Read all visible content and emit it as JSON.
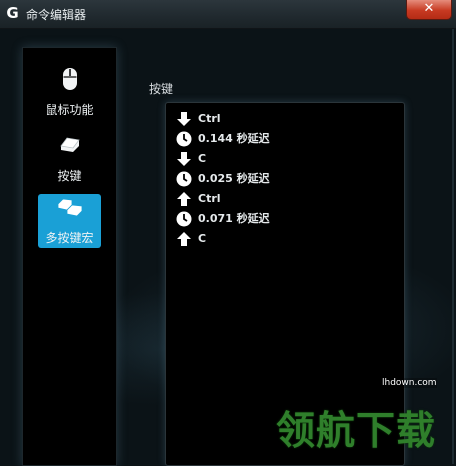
{
  "window": {
    "title": "命令编辑器",
    "logo_letter": "G",
    "ghost_text": "     ",
    "close_label": "✕"
  },
  "sidebar": {
    "items": [
      {
        "label": "鼠标功能",
        "icon": "mouse-icon",
        "active": false
      },
      {
        "label": "按键",
        "icon": "key-icon",
        "active": false
      },
      {
        "label": "多按键宏",
        "icon": "multi-key-icon",
        "active": true
      }
    ]
  },
  "main": {
    "section_label": "按键",
    "events": [
      {
        "icon": "arrow-down-icon",
        "text": "Ctrl"
      },
      {
        "icon": "clock-icon",
        "text": "0.144 秒延迟"
      },
      {
        "icon": "arrow-down-icon",
        "text": "C"
      },
      {
        "icon": "clock-icon",
        "text": "0.025 秒延迟"
      },
      {
        "icon": "arrow-up-icon",
        "text": "Ctrl"
      },
      {
        "icon": "clock-icon",
        "text": "0.071 秒延迟"
      },
      {
        "icon": "arrow-up-icon",
        "text": "C"
      }
    ]
  },
  "watermark": {
    "url": "lhdown.com",
    "text": "领航下载"
  },
  "colors": {
    "accent": "#1aa0d6",
    "close": "#c73a22",
    "watermark": "#2f7f2b"
  }
}
